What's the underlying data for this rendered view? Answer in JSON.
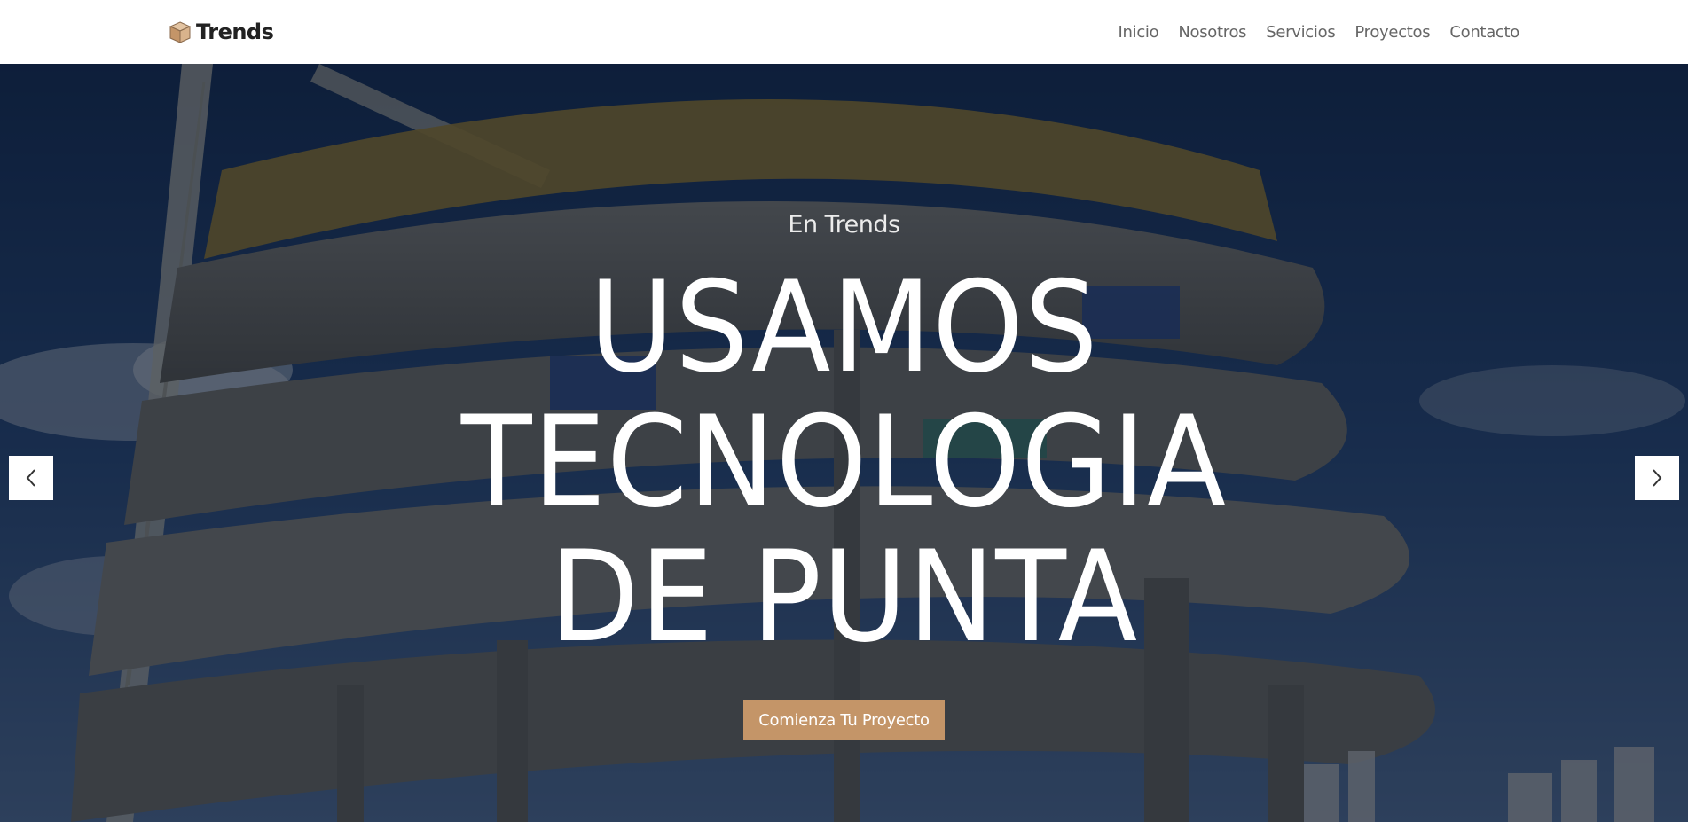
{
  "header": {
    "brand": {
      "icon": "box-icon",
      "name": "Trends"
    },
    "nav": [
      {
        "label": "Inicio"
      },
      {
        "label": "Nosotros"
      },
      {
        "label": "Servicios"
      },
      {
        "label": "Proyectos"
      },
      {
        "label": "Contacto"
      }
    ]
  },
  "hero": {
    "eyebrow": "En Trends",
    "headline_lines": [
      "USAMOS",
      "TECNOLOGIA",
      "DE PUNTA"
    ],
    "cta_label": "Comienza Tu Proyecto",
    "prev_icon": "chevron-left-icon",
    "next_icon": "chevron-right-icon",
    "background": "construction-building-photo"
  },
  "colors": {
    "accent": "#c49568",
    "header_bg": "#ffffff",
    "nav_text": "#666666",
    "brand_text": "#222222",
    "overlay": "#0a101e"
  }
}
